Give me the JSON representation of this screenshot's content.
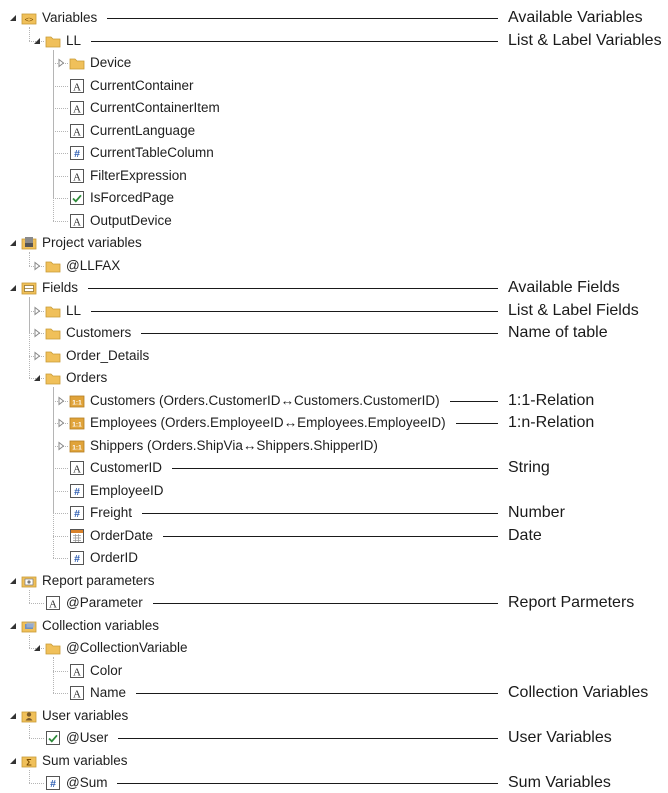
{
  "tree": [
    {
      "label": "Variables",
      "icon": "variables-root-icon",
      "depth": 0,
      "expander": "expanded"
    },
    {
      "label": "LL",
      "icon": "folder-icon",
      "depth": 1,
      "expander": "expanded"
    },
    {
      "label": "Device",
      "icon": "folder-icon",
      "depth": 2,
      "expander": "collapsed"
    },
    {
      "label": "CurrentContainer",
      "icon": "text-type-icon",
      "depth": 2,
      "expander": "none"
    },
    {
      "label": "CurrentContainerItem",
      "icon": "text-type-icon",
      "depth": 2,
      "expander": "none"
    },
    {
      "label": "CurrentLanguage",
      "icon": "text-type-icon",
      "depth": 2,
      "expander": "none"
    },
    {
      "label": "CurrentTableColumn",
      "icon": "number-type-icon",
      "depth": 2,
      "expander": "none"
    },
    {
      "label": "FilterExpression",
      "icon": "text-type-icon",
      "depth": 2,
      "expander": "none"
    },
    {
      "label": "IsForcedPage",
      "icon": "boolean-type-icon",
      "depth": 2,
      "expander": "none"
    },
    {
      "label": "OutputDevice",
      "icon": "text-type-icon",
      "depth": 2,
      "expander": "none"
    },
    {
      "label": "Project variables",
      "icon": "project-variables-icon",
      "depth": 0,
      "expander": "expanded"
    },
    {
      "label": "@LLFAX",
      "icon": "folder-icon",
      "depth": 1,
      "expander": "collapsed"
    },
    {
      "label": "Fields",
      "icon": "fields-root-icon",
      "depth": 0,
      "expander": "expanded"
    },
    {
      "label": "LL",
      "icon": "folder-icon",
      "depth": 1,
      "expander": "collapsed"
    },
    {
      "label": "Customers",
      "icon": "folder-icon",
      "depth": 1,
      "expander": "collapsed"
    },
    {
      "label": "Order_Details",
      "icon": "folder-icon",
      "depth": 1,
      "expander": "collapsed"
    },
    {
      "label": "Orders",
      "icon": "folder-icon",
      "depth": 1,
      "expander": "expanded"
    },
    {
      "label": "Customers (Orders.CustomerID↔Customers.CustomerID)",
      "icon": "relation-1-1-icon",
      "depth": 2,
      "expander": "collapsed"
    },
    {
      "label": "Employees (Orders.EmployeeID↔Employees.EmployeeID)",
      "icon": "relation-1-1-icon",
      "depth": 2,
      "expander": "collapsed"
    },
    {
      "label": "Shippers (Orders.ShipVia↔Shippers.ShipperID)",
      "icon": "relation-1-1-icon",
      "depth": 2,
      "expander": "collapsed"
    },
    {
      "label": "CustomerID",
      "icon": "text-type-icon",
      "depth": 2,
      "expander": "none"
    },
    {
      "label": "EmployeeID",
      "icon": "number-type-icon",
      "depth": 2,
      "expander": "none"
    },
    {
      "label": "Freight",
      "icon": "number-type-icon",
      "depth": 2,
      "expander": "none"
    },
    {
      "label": "OrderDate",
      "icon": "date-type-icon",
      "depth": 2,
      "expander": "none"
    },
    {
      "label": "OrderID",
      "icon": "number-type-icon",
      "depth": 2,
      "expander": "none"
    },
    {
      "label": "Report parameters",
      "icon": "report-parameters-icon",
      "depth": 0,
      "expander": "expanded"
    },
    {
      "label": "@Parameter",
      "icon": "text-type-icon",
      "depth": 1,
      "expander": "none"
    },
    {
      "label": "Collection variables",
      "icon": "collection-variables-icon",
      "depth": 0,
      "expander": "expanded"
    },
    {
      "label": "@CollectionVariable",
      "icon": "folder-icon",
      "depth": 1,
      "expander": "expanded"
    },
    {
      "label": "Color",
      "icon": "text-type-icon",
      "depth": 2,
      "expander": "none"
    },
    {
      "label": "Name",
      "icon": "text-type-icon",
      "depth": 2,
      "expander": "none"
    },
    {
      "label": "User variables",
      "icon": "user-variables-icon",
      "depth": 0,
      "expander": "expanded"
    },
    {
      "label": "@User",
      "icon": "boolean-type-icon",
      "depth": 1,
      "expander": "none"
    },
    {
      "label": "Sum variables",
      "icon": "sum-variables-icon",
      "depth": 0,
      "expander": "expanded"
    },
    {
      "label": "@Sum",
      "icon": "number-type-icon",
      "depth": 1,
      "expander": "none"
    }
  ],
  "annotations": [
    {
      "text": "Available Variables",
      "row": 0
    },
    {
      "text": "List & Label Variables",
      "row": 1
    },
    {
      "text": "Available Fields",
      "row": 12
    },
    {
      "text": "List & Label Fields",
      "row": 13
    },
    {
      "text": "Name of table",
      "row": 14
    },
    {
      "text": "1:1-Relation",
      "row": 17
    },
    {
      "text": "1:n-Relation",
      "row": 18
    },
    {
      "text": "String",
      "row": 20
    },
    {
      "text": "Number",
      "row": 22
    },
    {
      "text": "Date",
      "row": 23
    },
    {
      "text": "Report Parmeters",
      "row": 26
    },
    {
      "text": "Collection Variables",
      "row": 30
    },
    {
      "text": "User Variables",
      "row": 32
    },
    {
      "text": "Sum Variables",
      "row": 34
    }
  ],
  "colors": {
    "folder": "#f0c05a",
    "type_border": "#555555",
    "number_blue": "#2f5fb3",
    "check_green": "#2e8b3a",
    "relation_orange": "#e0a33a",
    "guide": "#b5b5b5",
    "text": "#1e1e1e"
  }
}
